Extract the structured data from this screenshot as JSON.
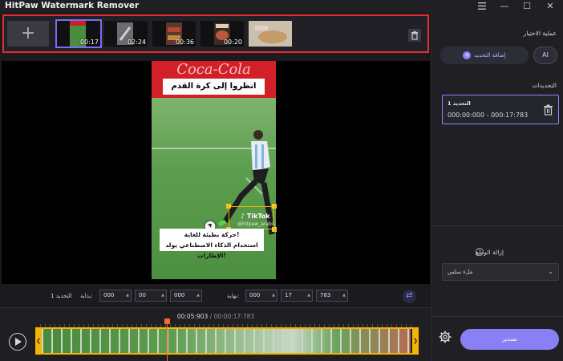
{
  "app": {
    "title": "HitPaw Watermark Remover"
  },
  "window_controls": {
    "menu_icon": "hamburger-icon",
    "minimize": "—",
    "maximize": "☐",
    "close": "✕"
  },
  "thumbnails": [
    {
      "duration": "00:17",
      "selected": true
    },
    {
      "duration": "02:24",
      "selected": false
    },
    {
      "duration": "00:36",
      "selected": false
    },
    {
      "duration": "00:20",
      "selected": false
    },
    {
      "duration": "",
      "selected": false
    }
  ],
  "add_tile_label": "+",
  "video": {
    "brand_text": "Coca-Cola",
    "headline": "انظروا إلى كرة القدم هذه",
    "watermark_text": "TikTok",
    "watermark_handle": "@hitpaw_arabic",
    "caption_line1": "حركة بطيئة للغاية!",
    "caption_line2": "استخدام الذكاء الاصطناعي يولد الإطارات!"
  },
  "range": {
    "selection_label": "التحديد 1",
    "start_label": "بداية:",
    "start": [
      "000",
      "00",
      "000"
    ],
    "end_label": "نهاية:",
    "end": [
      "000",
      "17",
      "783"
    ]
  },
  "timeline": {
    "current": "00:05:903",
    "separator": " / ",
    "total": "00:00:17:783",
    "progress": 0.3389
  },
  "panel": {
    "process_title": "عملية الاختيار",
    "add_selection": "إضافة التحديد",
    "ai_label": "AI",
    "selections_title": "التحديدات",
    "selection_item": {
      "name": "التحديد 1",
      "range": "000:00:000 - 000:17:783"
    },
    "mode_title": "إزالة الوضع",
    "mode_value": "ملء سلس",
    "export": "تصدير"
  }
}
